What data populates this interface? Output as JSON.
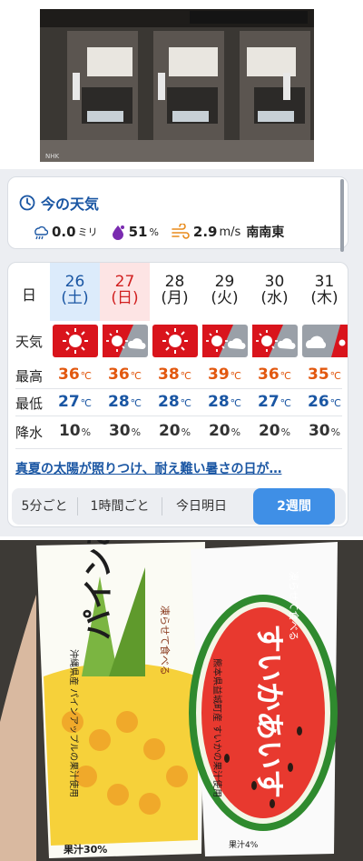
{
  "photo_top": {
    "alt": "ATM machines in a bank branch",
    "watermark": "NHK"
  },
  "weather": {
    "now": {
      "title": "今の天気",
      "rain_value": "0.0",
      "rain_unit": "ミリ",
      "humidity_value": "51",
      "humidity_unit": "%",
      "wind_value": "2.9",
      "wind_unit": "m/s",
      "wind_dir": "南南東"
    },
    "forecast": {
      "labels": {
        "day": "日",
        "weather": "天気",
        "high": "最高",
        "low": "最低",
        "rain": "降水"
      },
      "days": [
        {
          "date": "26",
          "dow": "(土)",
          "high": "36",
          "low": "27",
          "rain": "10"
        },
        {
          "date": "27",
          "dow": "(日)",
          "high": "36",
          "low": "28",
          "rain": "30"
        },
        {
          "date": "28",
          "dow": "(月)",
          "high": "38",
          "low": "28",
          "rain": "20"
        },
        {
          "date": "29",
          "dow": "(火)",
          "high": "39",
          "low": "28",
          "rain": "20"
        },
        {
          "date": "30",
          "dow": "(水)",
          "high": "36",
          "low": "27",
          "rain": "20"
        },
        {
          "date": "31",
          "dow": "(木)",
          "high": "35",
          "low": "26",
          "rain": "30"
        }
      ],
      "temp_unit": "℃",
      "rain_unit": "%"
    },
    "headline": "真夏の太陽が照りつけ、耐え難い暑さの日が…",
    "tabs": [
      "5分ごと",
      "1時間ごと",
      "今日明日",
      "2週間"
    ]
  },
  "photo_bottom": {
    "left_pack": {
      "brand_text": "凍らせて食べる",
      "name": "パインあいす",
      "origin": "沖縄県産 パインアップルの果汁使用",
      "juice": "果汁30%"
    },
    "right_pack": {
      "brand_text": "凍らせて食べる",
      "name": "すいかあいす",
      "origin": "熊本県益城町産 すいかの果汁使用",
      "juice": "果汁4%"
    }
  }
}
